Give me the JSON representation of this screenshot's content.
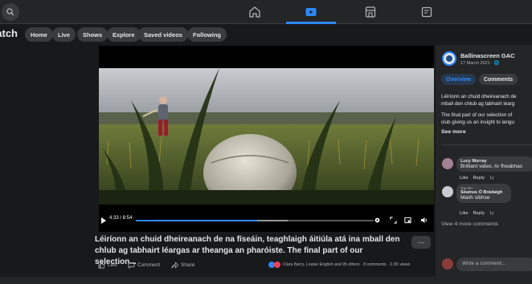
{
  "topnav": {
    "items": [
      {
        "icon": "home-icon",
        "active": false
      },
      {
        "icon": "watch-icon",
        "active": true
      },
      {
        "icon": "marketplace-icon",
        "active": false
      },
      {
        "icon": "feeds-icon",
        "active": false
      }
    ]
  },
  "subnav": {
    "title": "Watch",
    "pills": [
      "Home",
      "Live",
      "Shows",
      "Explore",
      "Saved videos",
      "Following"
    ]
  },
  "video": {
    "time": "4:33 / 8:54",
    "progress": 0.51,
    "buffered": 0.64,
    "caption_line1": "Léiríonn an chuid dheireanach de na físeáin, teaghlaigh áitiúla atá ina mball den",
    "caption_line2": "chlub ag tabhairt léargas ar theanga an pharóiste. The final part of our selection...",
    "more_label": "···"
  },
  "actions": {
    "like": "Like",
    "comment": "Comment",
    "share": "Share",
    "reactions_text": "Clara Barry, Louise English and 95 others · 8 comments · 2.3K views"
  },
  "panel": {
    "page_name": "Ballinascreen GAC",
    "date": "17 March 2021 · 🌐",
    "tabs": [
      "Overview",
      "Comments"
    ],
    "desc_lines": [
      "Léiríonn an chuid dheireanach de",
      "mball den chlub ag tabhairt léarg",
      "The final part of our selection of",
      "club giving us an insight to langu"
    ],
    "see_more": "See more",
    "comments": [
      {
        "name": "Lucy Murray",
        "text": "Brilliant video. Ar fheabhas",
        "meta": [
          "Like",
          "Reply",
          "1y"
        ]
      },
      {
        "fan": "Top fan",
        "name": "Séamus Ó Brádaigh",
        "text": "Maith sibhse",
        "meta": [
          "Like",
          "Reply",
          "1y"
        ]
      }
    ],
    "view_more": "View 4 more comments",
    "write_placeholder": "Write a comment..."
  },
  "colors": {
    "accent": "#2d88ff",
    "background": "#18191a",
    "surface": "#242526"
  }
}
